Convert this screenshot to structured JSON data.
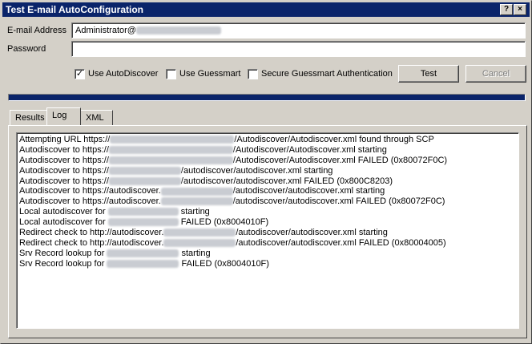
{
  "window": {
    "title": "Test E-mail AutoConfiguration",
    "help_glyph": "?",
    "close_glyph": "×"
  },
  "form": {
    "email_label": "E-mail Address",
    "email_value_prefix": "Administrator@",
    "password_label": "Password",
    "password_value": ""
  },
  "options": {
    "use_autodiscover": {
      "label": "Use AutoDiscover",
      "checked": true
    },
    "use_guessmart": {
      "label": "Use Guessmart",
      "checked": false
    },
    "secure_guessmart": {
      "label": "Secure Guessmart Authentication",
      "checked": false
    }
  },
  "buttons": {
    "test": "Test",
    "cancel": "Cancel"
  },
  "progress": {
    "fraction": 1.0
  },
  "tabs": [
    {
      "label": "Results",
      "active": false
    },
    {
      "label": "Log",
      "active": true
    },
    {
      "label": "XML",
      "active": false
    }
  ],
  "log": {
    "selected_index": 13,
    "lines": [
      {
        "pre": "Attempting URL https://",
        "post": "/Autodiscover/Autodiscover.xml found through SCP"
      },
      {
        "pre": "Autodiscover to https://",
        "post": "/Autodiscover/Autodiscover.xml starting"
      },
      {
        "pre": "Autodiscover to https://",
        "post": "/Autodiscover/Autodiscover.xml FAILED (0x80072F0C)"
      },
      {
        "pre": "Autodiscover to https://",
        "post": "/autodiscover/autodiscover.xml starting"
      },
      {
        "pre": "Autodiscover to https://",
        "post": "/autodiscover/autodiscover.xml FAILED (0x800C8203)"
      },
      {
        "pre": "Autodiscover to https://autodiscover.",
        "post": "/autodiscover/autodiscover.xml starting"
      },
      {
        "pre": "Autodiscover to https://autodiscover.",
        "post": "/autodiscover/autodiscover.xml FAILED (0x80072F0C)"
      },
      {
        "pre": "Local autodiscover for ",
        "post": " starting"
      },
      {
        "pre": "Local autodiscover for ",
        "post": " FAILED (0x8004010F)"
      },
      {
        "pre": "Redirect check to http://autodiscover.",
        "post": "/autodiscover/autodiscover.xml starting"
      },
      {
        "pre": "Redirect check to http://autodiscover.",
        "post": "/autodiscover/autodiscover.xml FAILED (0x80004005)"
      },
      {
        "pre": "Srv Record lookup for ",
        "post": " starting"
      },
      {
        "pre": "Srv Record lookup for ",
        "post": " FAILED (0x8004010F)"
      }
    ]
  }
}
